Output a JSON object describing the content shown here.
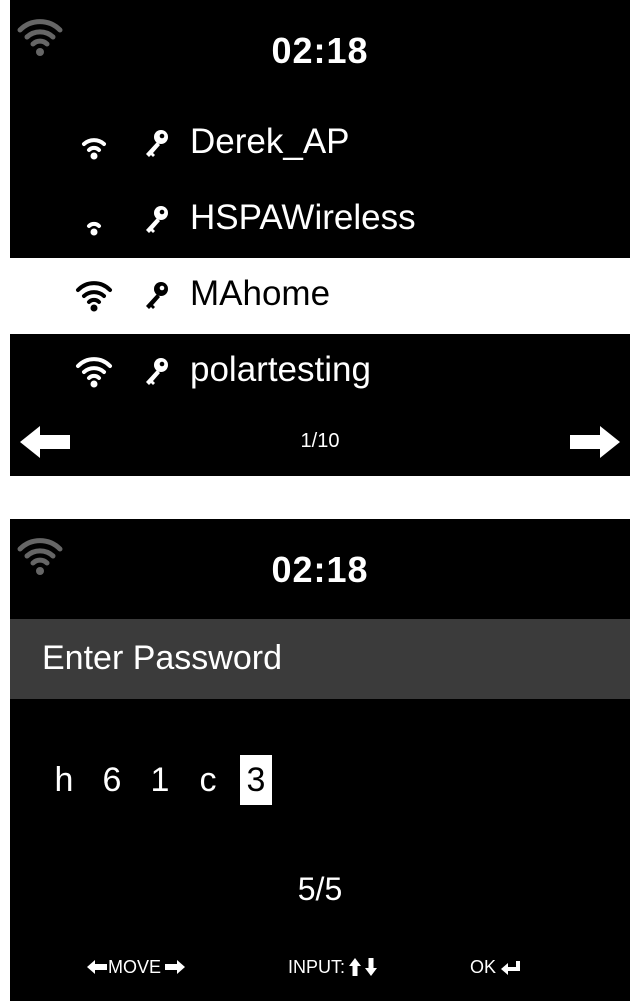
{
  "wifi_list_screen": {
    "time": "02:18",
    "networks": [
      {
        "ssid": "Derek_AP",
        "signal_bars": 3,
        "secured": true,
        "selected": false
      },
      {
        "ssid": "HSPAWireless",
        "signal_bars": 2,
        "secured": true,
        "selected": false
      },
      {
        "ssid": "MAhome",
        "signal_bars": 4,
        "secured": true,
        "selected": true
      },
      {
        "ssid": "polartesting",
        "signal_bars": 4,
        "secured": true,
        "selected": false
      }
    ],
    "page_indicator": "1/10"
  },
  "password_screen": {
    "time": "02:18",
    "title": "Enter Password",
    "password_chars": [
      "h",
      "6",
      "1",
      "c",
      "3"
    ],
    "cursor_index": 4,
    "counter": "5/5",
    "hints": {
      "move_label": "MOVE",
      "input_label": "INPUT:",
      "ok_label": "OK"
    }
  },
  "colors": {
    "screen_bg": "#000000",
    "selected_row_bg": "#ffffff",
    "title_bar_bg": "#3b3b3b",
    "text": "#ffffff"
  },
  "icons": [
    "wifi-status-icon",
    "wifi-signal-icon",
    "key-icon",
    "arrow-left-icon",
    "arrow-right-icon",
    "arrow-up-icon",
    "arrow-down-icon",
    "enter-icon"
  ]
}
